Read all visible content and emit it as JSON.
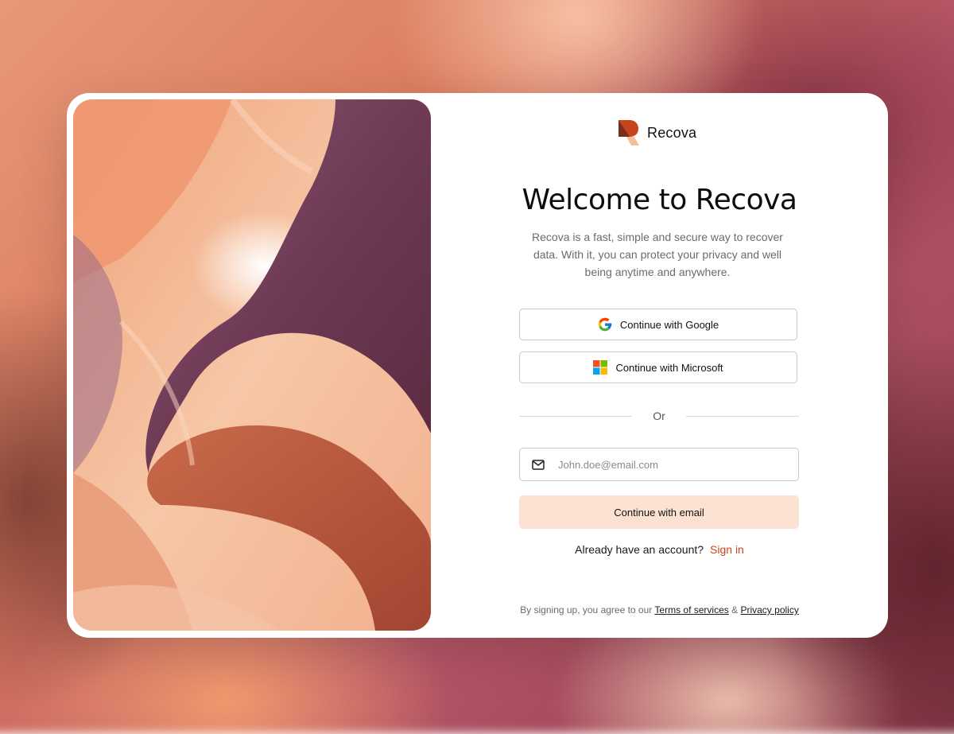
{
  "brand": {
    "name": "Recova",
    "icon": "recova-logo-icon"
  },
  "hero": {
    "title": "Welcome to Recova",
    "subtitle": "Recova is a fast, simple and secure way to recover data. With it, you can protect your privacy and well being anytime and anywhere."
  },
  "auth": {
    "google_label": "Continue with Google",
    "microsoft_label": "Continue with Microsoft",
    "divider_label": "Or",
    "email_placeholder": "John.doe@email.com",
    "email_value": "",
    "email_button_label": "Continue with email"
  },
  "signin": {
    "prompt": "Already have an account?",
    "link_label": "Sign in"
  },
  "legal": {
    "prefix": "By signing up, you agree to our",
    "terms_label": "Terms of services",
    "amp": "&",
    "privacy_label": "Privacy policy"
  },
  "colors": {
    "accent": "#c8451c",
    "email_button_bg": "#fbe1d2",
    "card_bg": "#ffffff"
  }
}
